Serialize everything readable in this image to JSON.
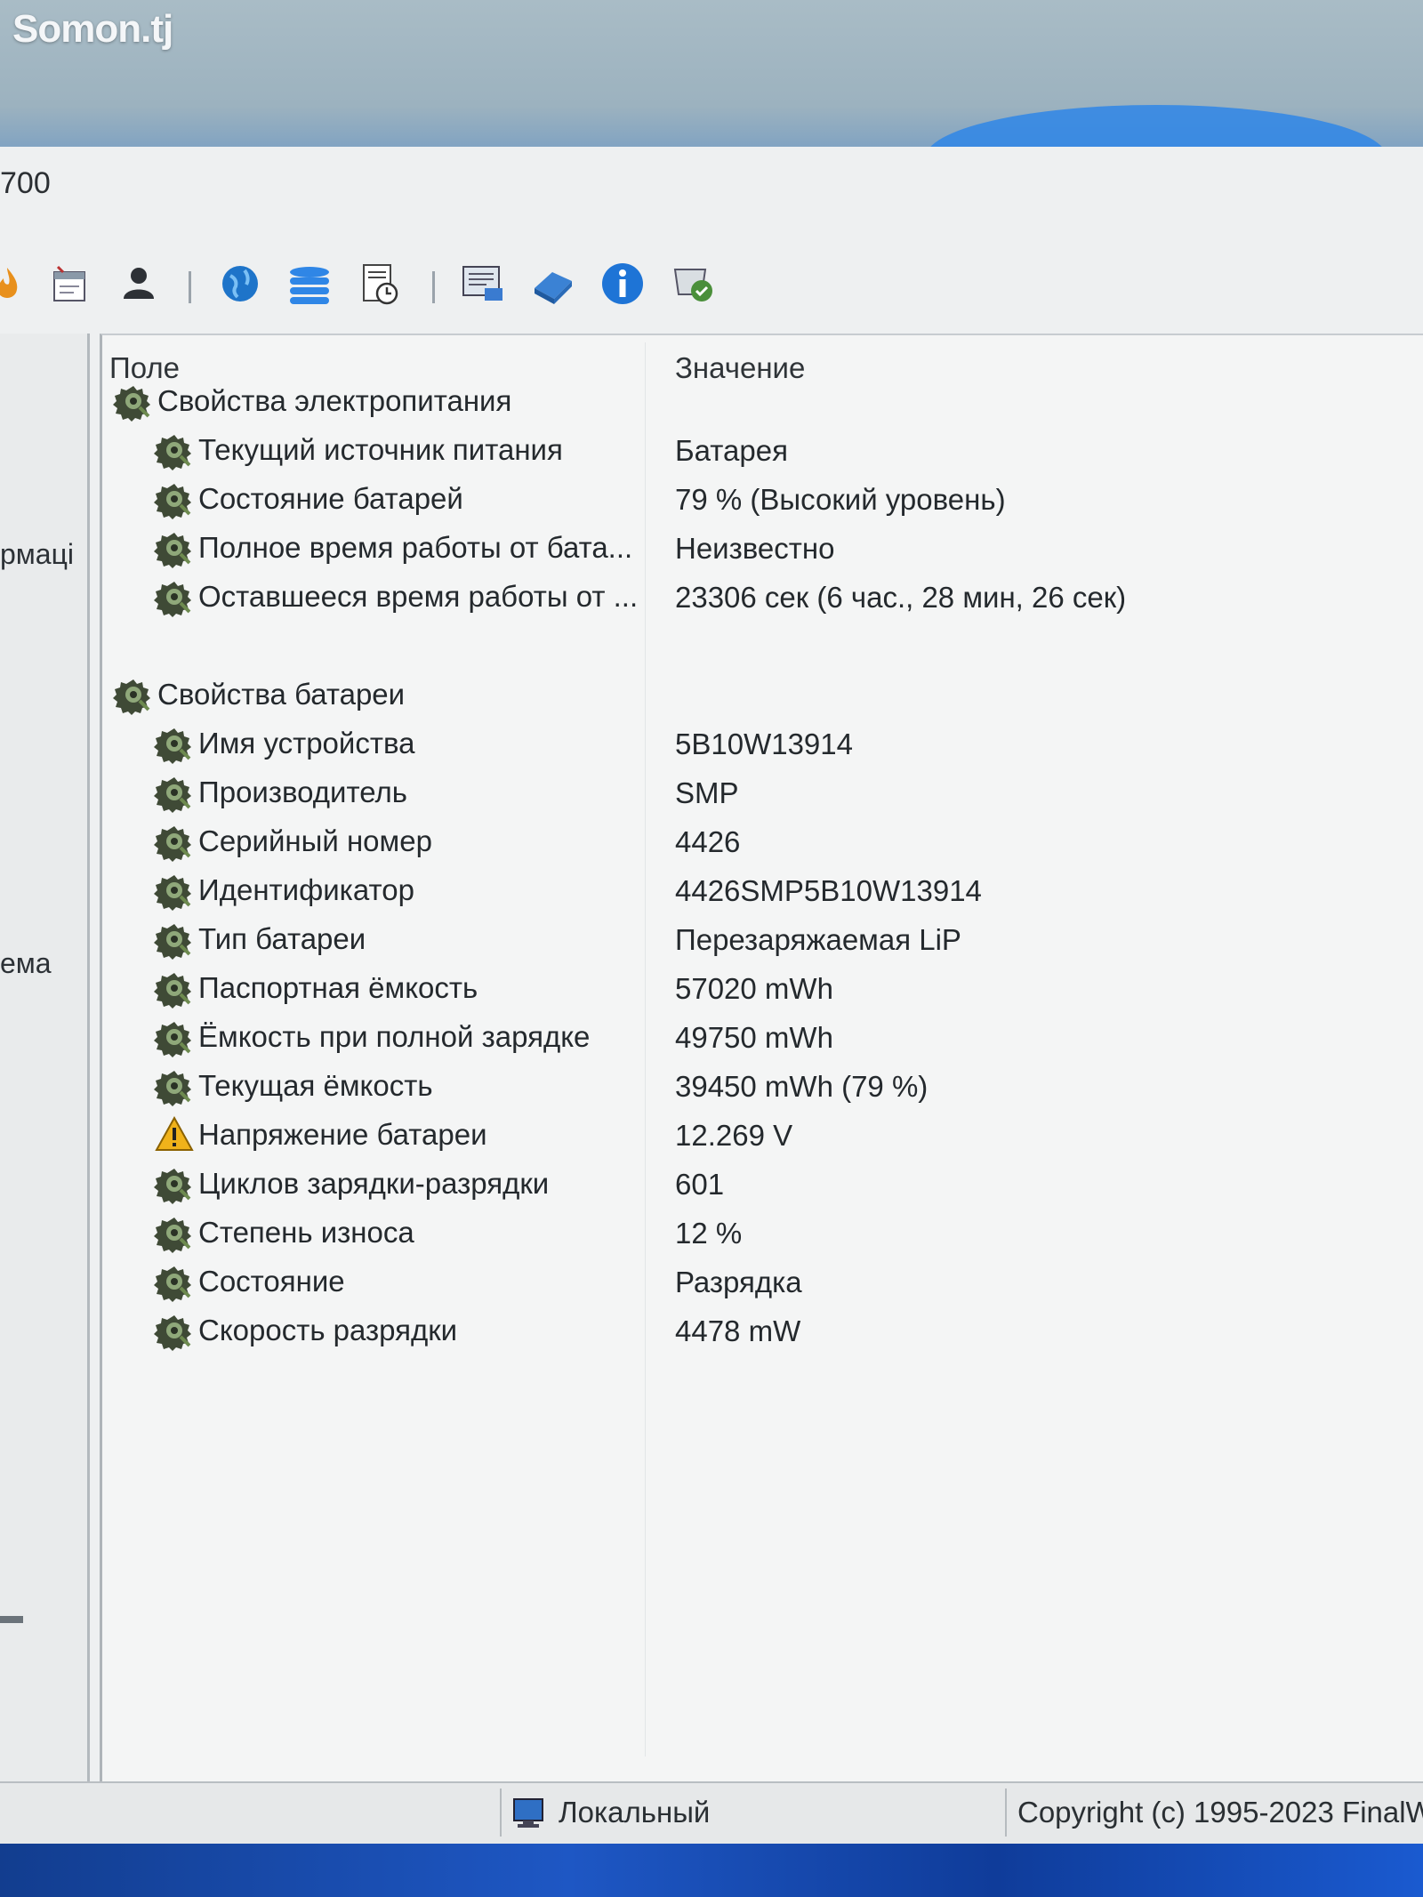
{
  "watermark": "Somon.tj",
  "window": {
    "title_fragment": "700"
  },
  "toolbar": {
    "icons": [
      "fire-icon",
      "calendar-icon",
      "user-icon",
      "globe-icon",
      "database-icon",
      "report-clock-icon",
      "report-icon",
      "network-icon",
      "info-icon",
      "benchmark-icon"
    ]
  },
  "left_pane": {
    "items": [
      "рмаці",
      "ема"
    ]
  },
  "columns": {
    "field": "Поле",
    "value": "Значение"
  },
  "groups": [
    {
      "title": "Свойства электропитания",
      "rows": [
        {
          "field": "Текущий источник питания",
          "value": "Батарея"
        },
        {
          "field": "Состояние батарей",
          "value": "79 % (Высокий уровень)"
        },
        {
          "field": "Полное время работы от бата...",
          "value": "Неизвестно"
        },
        {
          "field": "Оставшееся время работы от ...",
          "value": "23306 сек (6 час., 28 мин, 26 сек)"
        }
      ]
    },
    {
      "title": "Свойства батареи",
      "rows": [
        {
          "field": "Имя устройства",
          "value": "5B10W13914"
        },
        {
          "field": "Производитель",
          "value": "SMP"
        },
        {
          "field": "Серийный номер",
          "value": "4426"
        },
        {
          "field": "Идентификатор",
          "value": "4426SMP5B10W13914"
        },
        {
          "field": "Тип батареи",
          "value": "Перезаряжаемая LiP"
        },
        {
          "field": "Паспортная ёмкость",
          "value": "57020 mWh"
        },
        {
          "field": "Ёмкость при полной зарядке",
          "value": "49750 mWh"
        },
        {
          "field": "Текущая ёмкость",
          "value": "39450 mWh  (79 %)"
        },
        {
          "field": "Напряжение батареи",
          "value": "12.269 V",
          "icon": "warning-icon"
        },
        {
          "field": "Циклов зарядки-разрядки",
          "value": "601"
        },
        {
          "field": "Степень износа",
          "value": "12 %"
        },
        {
          "field": "Состояние",
          "value": "Разрядка"
        },
        {
          "field": "Скорость разрядки",
          "value": "4478 mW"
        }
      ]
    }
  ],
  "statusbar": {
    "local": "Локальный",
    "copyright": "Copyright (c) 1995-2023 FinalW"
  },
  "colors": {
    "accent": "#2f86e6",
    "taskbar": "#1e57c4"
  }
}
